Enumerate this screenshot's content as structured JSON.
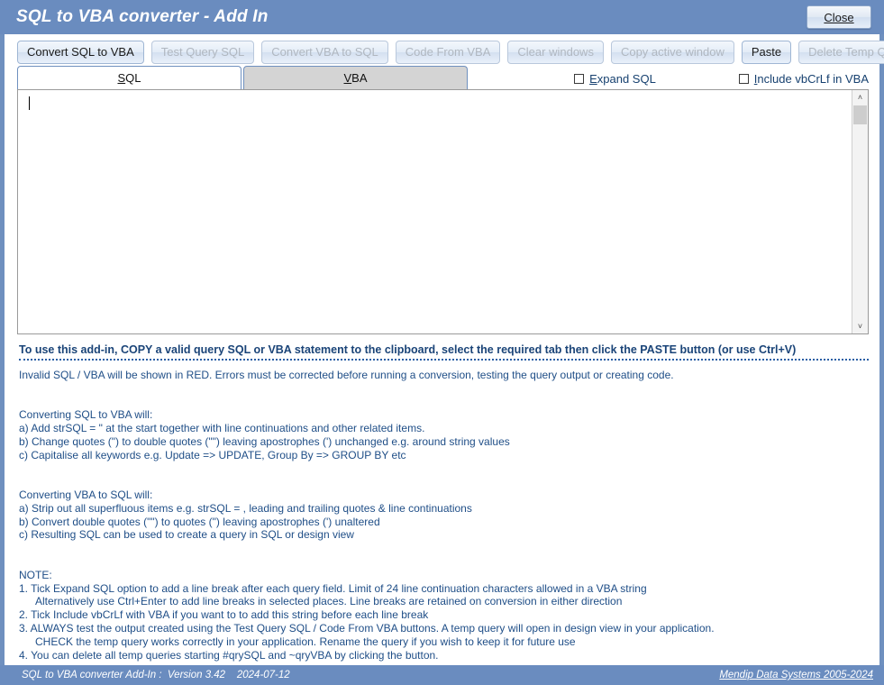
{
  "window": {
    "title": "SQL to VBA converter - Add In",
    "close_label": "Close"
  },
  "toolbar": {
    "buttons": [
      {
        "label": "Convert SQL to VBA",
        "enabled": true
      },
      {
        "label": "Test Query SQL",
        "enabled": false
      },
      {
        "label": "Convert VBA to SQL",
        "enabled": false
      },
      {
        "label": "Code From VBA",
        "enabled": false
      },
      {
        "label": "Clear windows",
        "enabled": false
      },
      {
        "label": "Copy active window",
        "enabled": false
      },
      {
        "label": "Paste",
        "enabled": true
      },
      {
        "label": "Delete Temp Queries",
        "enabled": false
      }
    ]
  },
  "tabs": [
    {
      "label": "SQL",
      "accel": "S",
      "active": true
    },
    {
      "label": "VBA",
      "accel": "V",
      "active": false
    }
  ],
  "options": [
    {
      "label": "Expand SQL",
      "accel": "E",
      "checked": false
    },
    {
      "label": "Include vbCrLf in VBA",
      "accel": "I",
      "checked": false
    }
  ],
  "editor": {
    "value": "",
    "placeholder": ""
  },
  "help": {
    "headline": "To use this add-in, COPY a valid query SQL or VBA statement to the clipboard, select the required tab then click the PASTE button (or use Ctrl+V)",
    "line_invalid": "Invalid SQL / VBA will be shown in RED. Errors must be corrected before running a conversion, testing the query output or creating code.",
    "sql_to_vba_title": "Converting SQL to VBA will:",
    "sql_to_vba_a": "a) Add strSQL = \" at the start together with line continuations and other related items.",
    "sql_to_vba_b": "b) Change quotes (\") to double quotes (\"\")  leaving apostrophes (') unchanged e.g. around string values",
    "sql_to_vba_c": "c) Capitalise all keywords e.g. Update => UPDATE, Group By => GROUP BY etc",
    "vba_to_sql_title": "Converting VBA to SQL will:",
    "vba_to_sql_a": "a) Strip out all superfluous items e.g. strSQL = , leading and trailing quotes & line continuations",
    "vba_to_sql_b": "b) Convert double quotes (\"\") to quotes (\") leaving apostrophes (') unaltered",
    "vba_to_sql_c": "c) Resulting SQL can be used to create a query in SQL or design view",
    "note_title": "NOTE:",
    "note_1": "1.  Tick Expand SQL option to add a line break after each query field. Limit of 24 line continuation characters allowed in a VBA string",
    "note_1b": "Alternatively use Ctrl+Enter to add line breaks in selected places. Line breaks are retained on conversion in either direction",
    "note_2": "2.  Tick Include vbCrLf with VBA if you want to to add this string before each line break",
    "note_3": "3.  ALWAYS test the output created using the Test Query SQL / Code From VBA buttons. A temp query will open in design view in your application.",
    "note_3b": "CHECK the temp query works correctly in your application. Rename the query if you wish to keep it for future use",
    "note_4": "4.  You can delete all temp queries starting #qrySQL and ~qryVBA by clicking the button."
  },
  "statusbar": {
    "left": "SQL to VBA converter Add-In :  Version 3.42    2024-07-12",
    "link": "Mendip Data Systems 2005-2024"
  },
  "icons": {
    "scroll_up": "˄",
    "scroll_down": "˅"
  },
  "colors": {
    "chrome": "#6a8cbf",
    "border": "#6f90bf",
    "help_text": "#1f4e87",
    "tab_inactive": "#d4d4d4"
  }
}
